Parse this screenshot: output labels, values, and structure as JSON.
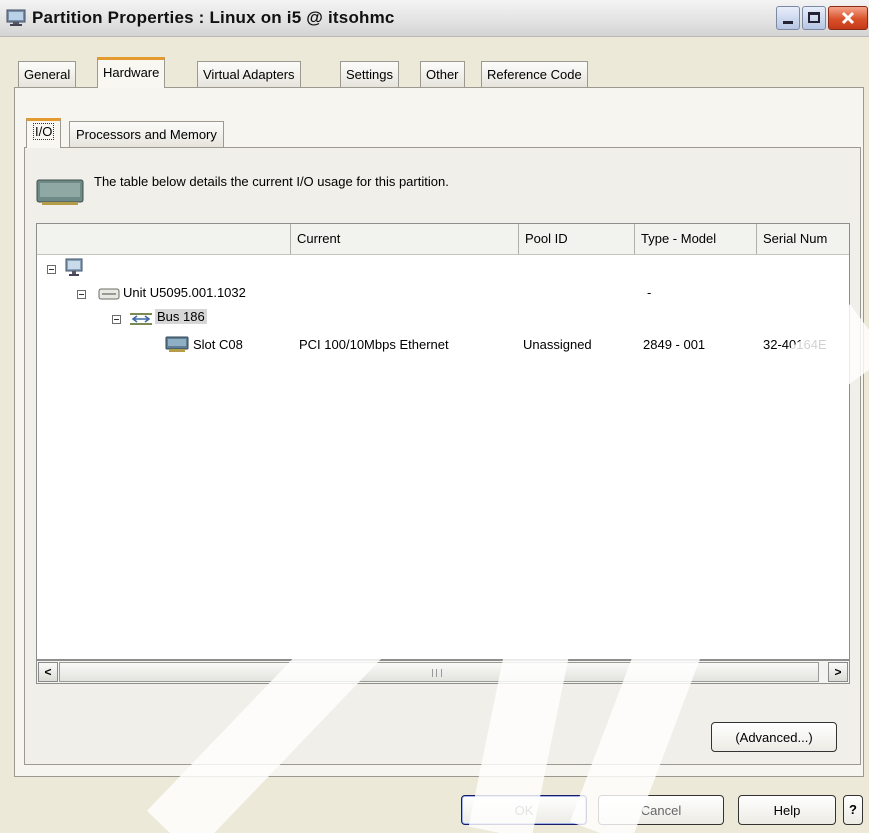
{
  "window": {
    "title": "Partition Properties : Linux on i5 @ itsohmc",
    "icon": "monitor-icon",
    "controls": [
      "minimize-icon",
      "maximize-icon",
      "close-icon"
    ]
  },
  "tabs": [
    "General",
    "Hardware",
    "Virtual Adapters",
    "Settings",
    "Other",
    "Reference Code"
  ],
  "active_tab": "Hardware",
  "subtabs": [
    "I/O",
    "Processors and Memory"
  ],
  "active_subtab": "I/O",
  "description": "The table below details the current I/O usage for this partition.",
  "table": {
    "columns": [
      "",
      "Current",
      "Pool ID",
      "Type - Model",
      "Serial Num"
    ],
    "rows": {
      "root": {
        "label": "",
        "icon": "system-icon"
      },
      "unit": {
        "label": "Unit U5095.001.1032",
        "icon": "unit-drawer-icon",
        "type_model": "-"
      },
      "bus": {
        "label": "Bus 186",
        "icon": "bus-icon"
      },
      "slot": {
        "label": "Slot C08",
        "icon": "adapter-card-icon",
        "current": "PCI 100/10Mbps Ethernet",
        "pool_id": "Unassigned",
        "type_model": "2849 - 001",
        "serial": "32-40164E"
      }
    }
  },
  "scrollbar": {
    "left": "<",
    "right": ">"
  },
  "advanced_button": "(Advanced...)",
  "footer": {
    "ok": "OK",
    "cancel": "Cancel",
    "help": "Help",
    "context_help": "?"
  },
  "colors": {
    "active_tab_accent": "#e39a2e",
    "close_button": "#d9512a",
    "dialog_bg": "#ece9d8"
  }
}
